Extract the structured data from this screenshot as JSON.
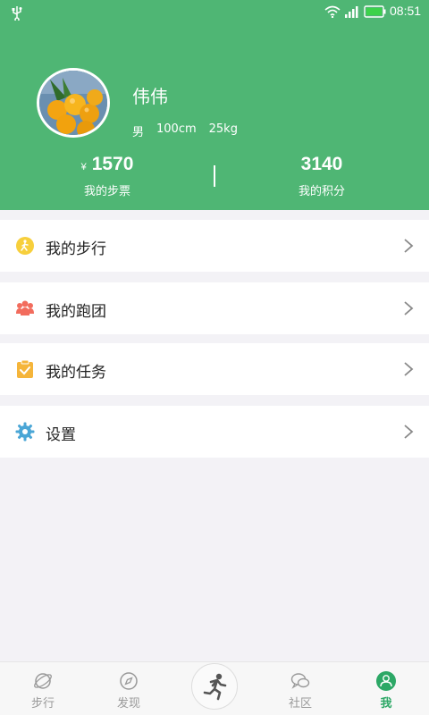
{
  "status_bar": {
    "time": "08:51"
  },
  "profile": {
    "name": "伟伟",
    "gender": "男",
    "height": "100cm",
    "weight": "25kg"
  },
  "stats": {
    "currency": "¥",
    "steps_value": "1570",
    "steps_label": "我的步票",
    "points_value": "3140",
    "points_label": "我的积分"
  },
  "menu": {
    "items": [
      {
        "label": "我的步行",
        "icon": "walk-icon"
      },
      {
        "label": "我的跑团",
        "icon": "group-icon"
      },
      {
        "label": "我的任务",
        "icon": "task-icon"
      },
      {
        "label": "设置",
        "icon": "gear-icon"
      }
    ]
  },
  "tabbar": {
    "tabs": [
      {
        "label": "步行",
        "icon": "planet-icon"
      },
      {
        "label": "发现",
        "icon": "compass-icon"
      },
      {
        "label": "",
        "icon": "runner-icon"
      },
      {
        "label": "社区",
        "icon": "chat-icon"
      },
      {
        "label": "我",
        "icon": "person-icon",
        "active": true
      }
    ]
  },
  "colors": {
    "brand_green": "#4fb674",
    "active_tab": "#2da866"
  }
}
